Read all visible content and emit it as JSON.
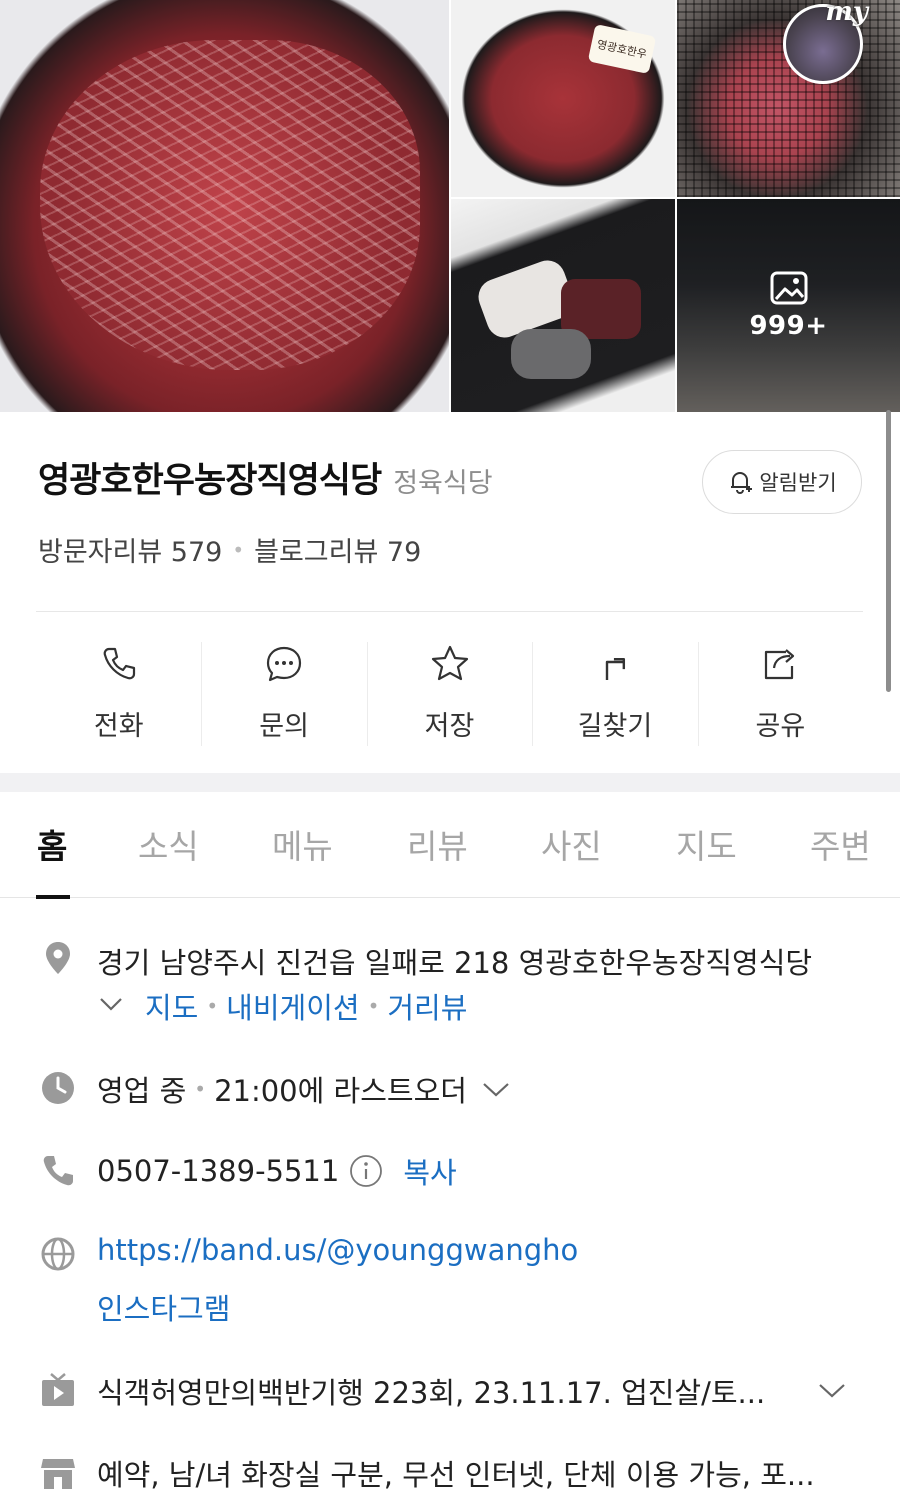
{
  "gallery": {
    "more_count": "999+",
    "tag_text": "영광호한우",
    "badge_text": "my"
  },
  "place": {
    "name": "영광호한우농장직영식당",
    "category": "정육식당",
    "alert_label": "알림받기",
    "visitor_reviews": "방문자리뷰 579",
    "blog_reviews": "블로그리뷰 79"
  },
  "actions": [
    {
      "label": "전화",
      "icon": "phone-icon"
    },
    {
      "label": "문의",
      "icon": "chat-icon"
    },
    {
      "label": "저장",
      "icon": "star-icon"
    },
    {
      "label": "길찾기",
      "icon": "directions-icon"
    },
    {
      "label": "공유",
      "icon": "share-icon"
    }
  ],
  "tabs": [
    "홈",
    "소식",
    "메뉴",
    "리뷰",
    "사진",
    "지도",
    "주변"
  ],
  "info": {
    "address": "경기 남양주시 진건읍 일패로 218 영광호한우농장직영식당",
    "address_links": [
      "지도",
      "내비게이션",
      "거리뷰"
    ],
    "hours_status": "영업 중",
    "hours_detail": "21:00에 라스트오더",
    "phone": "0507-1389-5511",
    "copy_label": "복사",
    "website": "https://band.us/@younggwangho",
    "instagram": "인스타그램",
    "tv": "식객허영만의백반기행 223회, 23.11.17. 업진살/토...",
    "amenities": "예약, 남/녀 화장실 구분, 무선 인터넷, 단체 이용 가능, 포..."
  },
  "colors": {
    "link_blue": "#1b6ec2",
    "icon_gray": "#9a9a9a"
  }
}
